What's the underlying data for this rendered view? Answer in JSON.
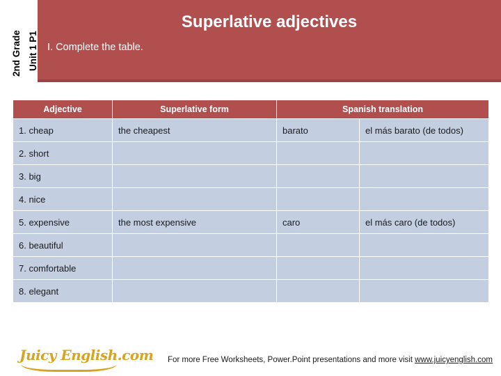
{
  "header": {
    "grade_label": "2nd Grade",
    "unit_label": "Unit 1 P1",
    "title": "Superlative adjectives",
    "instruction": "I. Complete the table.",
    "band_color": "#b14f4f"
  },
  "table": {
    "headers": [
      "Adjective",
      "Superlative form",
      "Spanish translation",
      ""
    ],
    "rows": [
      {
        "adjective": "1. cheap",
        "superlative": "the cheapest",
        "spanish_a": "barato",
        "spanish_b": "el más barato (de todos)"
      },
      {
        "adjective": "2. short",
        "superlative": "",
        "spanish_a": "",
        "spanish_b": ""
      },
      {
        "adjective": "3. big",
        "superlative": "",
        "spanish_a": "",
        "spanish_b": ""
      },
      {
        "adjective": "4. nice",
        "superlative": "",
        "spanish_a": "",
        "spanish_b": ""
      },
      {
        "adjective": "5. expensive",
        "superlative": "the most expensive",
        "spanish_a": "caro",
        "spanish_b": "el más caro (de todos)"
      },
      {
        "adjective": "6. beautiful",
        "superlative": "",
        "spanish_a": "",
        "spanish_b": ""
      },
      {
        "adjective": "7. comfortable",
        "superlative": "",
        "spanish_a": "",
        "spanish_b": ""
      },
      {
        "adjective": "8. elegant",
        "superlative": "",
        "spanish_a": "",
        "spanish_b": ""
      }
    ],
    "cell_color": "#c3cfe0"
  },
  "footer": {
    "logo_text": "Juicy English.com",
    "note_prefix": "For more Free Worksheets, Power.Point presentations and more visit ",
    "note_link": "www.juicyenglish.com",
    "logo_color": "#d8a31e"
  }
}
